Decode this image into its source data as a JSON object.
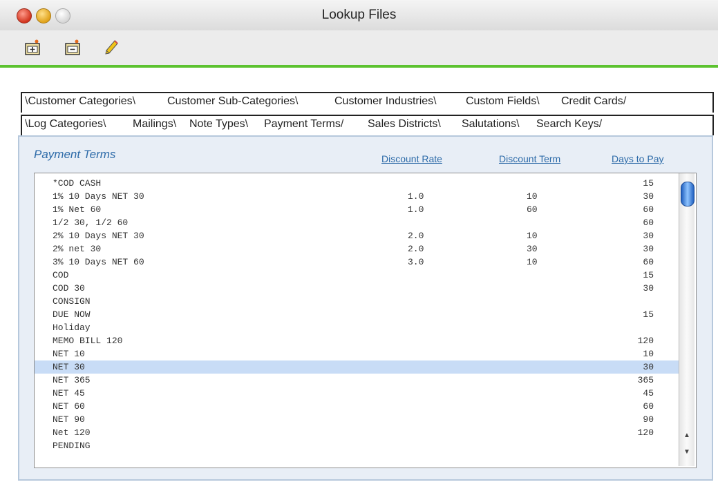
{
  "window": {
    "title": "Lookup Files"
  },
  "toolbar": {
    "icons": [
      "add-record-icon",
      "remove-record-icon",
      "edit-pencil-icon"
    ]
  },
  "tabs_row1": [
    "Customer Categories",
    "Customer Sub-Categories",
    "Customer Industries",
    "Custom Fields",
    "Credit Cards"
  ],
  "tabs_row2": [
    "Log Categories",
    "Mailings",
    "Note Types",
    "Payment Terms",
    "Sales Districts",
    "Salutations",
    "Search Keys"
  ],
  "active_tab": "Payment Terms",
  "panel": {
    "title": "Payment Terms",
    "columns": {
      "rate": "Discount Rate",
      "term": "Discount Term",
      "days": "Days to Pay"
    }
  },
  "rows": [
    {
      "name": "*COD CASH",
      "rate": "",
      "term": "",
      "days": "15"
    },
    {
      "name": "1% 10 Days NET 30",
      "rate": "1.0",
      "term": "10",
      "days": "30"
    },
    {
      "name": "1% Net 60",
      "rate": "1.0",
      "term": "60",
      "days": "60"
    },
    {
      "name": "1/2 30, 1/2 60",
      "rate": "",
      "term": "",
      "days": "60"
    },
    {
      "name": "2% 10 Days NET 30",
      "rate": "2.0",
      "term": "10",
      "days": "30"
    },
    {
      "name": "2% net 30",
      "rate": "2.0",
      "term": "30",
      "days": "30"
    },
    {
      "name": "3% 10 Days NET 60",
      "rate": "3.0",
      "term": "10",
      "days": "60"
    },
    {
      "name": "COD",
      "rate": "",
      "term": "",
      "days": "15"
    },
    {
      "name": "COD 30",
      "rate": "",
      "term": "",
      "days": "30"
    },
    {
      "name": "CONSIGN",
      "rate": "",
      "term": "",
      "days": ""
    },
    {
      "name": "DUE NOW",
      "rate": "",
      "term": "",
      "days": "15"
    },
    {
      "name": "Holiday",
      "rate": "",
      "term": "",
      "days": ""
    },
    {
      "name": "MEMO BILL 120",
      "rate": "",
      "term": "",
      "days": "120"
    },
    {
      "name": "NET 10",
      "rate": "",
      "term": "",
      "days": "10"
    },
    {
      "name": "NET 30",
      "rate": "",
      "term": "",
      "days": "30"
    },
    {
      "name": "NET 365",
      "rate": "",
      "term": "",
      "days": "365"
    },
    {
      "name": "NET 45",
      "rate": "",
      "term": "",
      "days": "45"
    },
    {
      "name": "NET 60",
      "rate": "",
      "term": "",
      "days": "60"
    },
    {
      "name": "NET 90",
      "rate": "",
      "term": "",
      "days": "90"
    },
    {
      "name": "Net 120",
      "rate": "",
      "term": "",
      "days": "120"
    },
    {
      "name": "PENDING",
      "rate": "",
      "term": "",
      "days": ""
    }
  ],
  "selected_row": "NET 30",
  "colors": {
    "accent": "#5cc22f",
    "heading": "#2c6aa8",
    "selection": "#c8dcf6"
  }
}
